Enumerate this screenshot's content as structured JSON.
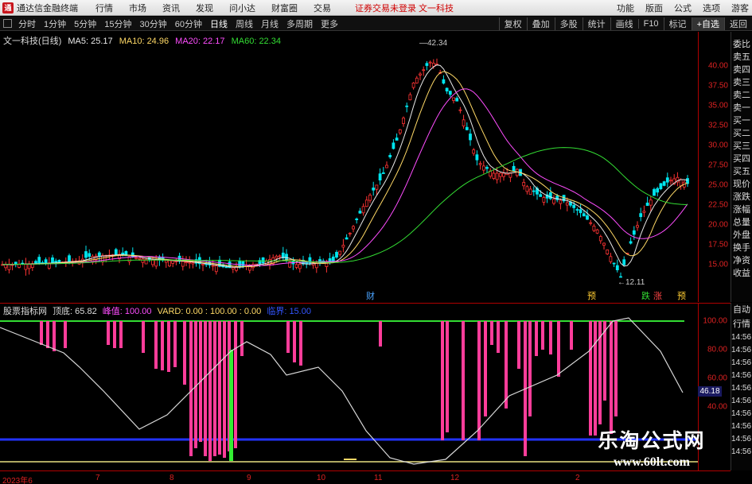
{
  "menubar": {
    "app_title": "通达信金融终端",
    "menus": [
      "行情",
      "市场",
      "资讯",
      "发现",
      "问小达",
      "财富圈",
      "交易"
    ],
    "notice": "证券交易未登录  文一科技",
    "right_items": [
      "功能",
      "版面",
      "公式",
      "选项",
      "游客"
    ]
  },
  "toolbar": {
    "periods": [
      "分时",
      "1分钟",
      "5分钟",
      "15分钟",
      "30分钟",
      "60分钟",
      "日线",
      "周线",
      "月线",
      "多周期",
      "更多"
    ],
    "active_period": "日线",
    "right_items": [
      "复权",
      "叠加",
      "多股",
      "统计",
      "画线",
      "F10",
      "标记",
      "+自选",
      "返回"
    ]
  },
  "main_chart": {
    "stock_label": "文一科技(日线)",
    "ma": [
      {
        "label": "MA5: 25.17",
        "color": "#e8e8e8"
      },
      {
        "label": "MA10: 24.96",
        "color": "#ffd966"
      },
      {
        "label": "MA20: 22.17",
        "color": "#ff4dff"
      },
      {
        "label": "MA60: 22.34",
        "color": "#33dd33"
      }
    ],
    "y_ticks": [
      "40.00",
      "37.50",
      "35.00",
      "32.50",
      "30.00",
      "27.50",
      "25.00",
      "22.50",
      "20.00",
      "17.50",
      "15.00"
    ],
    "high_label": "42.34",
    "low_label": "12.11",
    "event_markers": [
      {
        "text": "财",
        "color": "#4aa3ff"
      },
      {
        "text": "预",
        "color": "#ffcc33"
      },
      {
        "text": "跌",
        "color": "#33dd33"
      },
      {
        "text": "涨",
        "color": "#ff4444"
      },
      {
        "text": "预",
        "color": "#ffcc33"
      }
    ]
  },
  "right_panel": {
    "items": [
      "委比",
      "卖五",
      "卖四",
      "卖三",
      "卖二",
      "卖一",
      "买一",
      "买二",
      "买三",
      "买四",
      "买五",
      "现价",
      "涨跌",
      "涨幅",
      "总量",
      "外盘",
      "换手",
      "净资",
      "收益"
    ]
  },
  "indicator": {
    "name": "股票指标网",
    "fields": [
      {
        "text": "顶底: 65.82",
        "color": "#dddddd"
      },
      {
        "text": "峰值: 100.00",
        "color": "#ff4dff"
      },
      {
        "text": "VARD: 0.00 : 100.00 : 0.00",
        "color": "#ffd966"
      },
      {
        "text": "临界: 15.00",
        "color": "#3355ff"
      }
    ],
    "y_ticks": [
      "100.00",
      "80.00",
      "60.00",
      "40.00"
    ],
    "current_value": "46.18"
  },
  "right_panel2": {
    "items": [
      "自动",
      "行情"
    ],
    "times": [
      "14:56",
      "14:56",
      "14:56",
      "14:56",
      "14:56",
      "14:56",
      "14:56",
      "14:56",
      "14:56",
      "14:56"
    ]
  },
  "date_axis": [
    "2023年6",
    "7",
    "8",
    "9",
    "10",
    "11",
    "12",
    "2"
  ],
  "watermark": {
    "title": "乐淘公式网",
    "url": "www.60lt.com"
  },
  "colors": {
    "up": "#ff3333",
    "down": "#00e5ee",
    "axis": "#b00000",
    "peak_bar": "#ff3d9a"
  }
}
